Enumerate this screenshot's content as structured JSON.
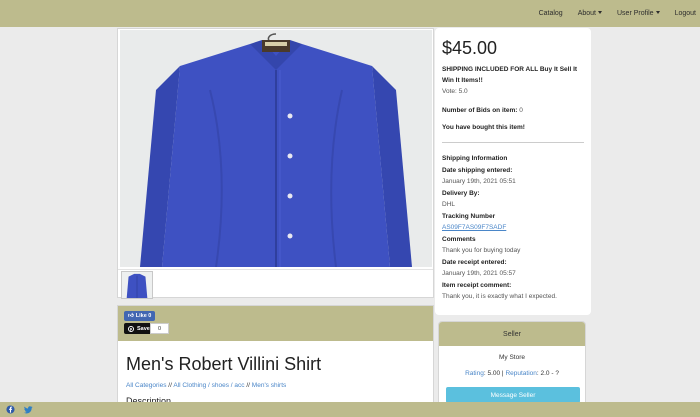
{
  "nav": {
    "items": [
      {
        "label": "Catalog",
        "dropdown": false
      },
      {
        "label": "About",
        "dropdown": true
      },
      {
        "label": "User Profile",
        "dropdown": true
      },
      {
        "label": "Logout",
        "dropdown": false
      }
    ]
  },
  "gallery": {
    "main_image": "blue-button-up-shirt-on-hanger",
    "thumbnails": [
      "blue-button-up-shirt-thumbnail"
    ]
  },
  "listing": {
    "price": "$45.00",
    "shipping_note": "SHIPPING INCLUDED FOR ALL Buy It Sell It Win It Items!!",
    "vote": "Vote: 5.0",
    "bids_label": "Number of Bids on item: ",
    "bids_value": "0",
    "bought_note": "You have bought this item!"
  },
  "shipping": {
    "section_title": "Shipping Information",
    "date_entered_label": "Date shipping entered:",
    "date_entered_value": "January 19th, 2021 05:51",
    "delivery_label": "Delivery By:",
    "delivery_value": "DHL",
    "tracking_label": "Tracking Number",
    "tracking_value": "AS09F7AS09F7SADF",
    "comments_label": "Comments",
    "comments_value": "Thank you for buying today",
    "receipt_date_label": "Date receipt entered:",
    "receipt_date_value": "January 19th, 2021 05:57",
    "receipt_comment_label": "Item receipt comment:",
    "receipt_comment_value": "Thank you, it is exactly what I expected."
  },
  "social_share": {
    "like_label": "Like 0",
    "save_label": "Save",
    "save_count": "0"
  },
  "product": {
    "title": "Men's Robert Villini Shirt",
    "breadcrumb": [
      "All Categories",
      "All Clothing / shoes / acc",
      "Men's shirts"
    ],
    "breadcrumb_separator": "//",
    "description_heading": "Description"
  },
  "seller": {
    "heading": "Seller",
    "name": "My Store",
    "rating_label": "Rating",
    "rating_value": ": 5.00 | ",
    "reputation_label": "Reputation",
    "reputation_value": ": 2.0 - ?",
    "message_button": "Message Seller"
  },
  "footer": {
    "icons": [
      "facebook-icon",
      "twitter-icon"
    ]
  },
  "colors": {
    "bar": "#bdbb8d",
    "page_bg": "#ebebeb",
    "link": "#4a86c8",
    "button": "#5bc0de",
    "shirt": "#3e51c2"
  }
}
